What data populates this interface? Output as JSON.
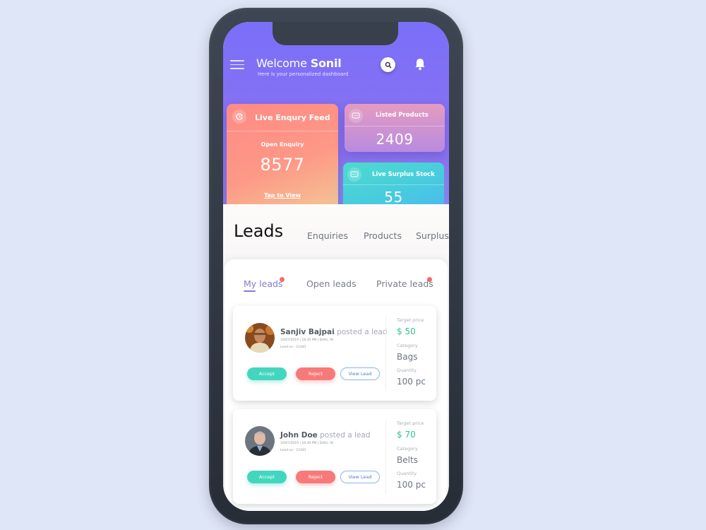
{
  "header": {
    "welcome_prefix": "Welcome",
    "user_name": "Sonil",
    "subtitle": "Here is your personalized dashboard"
  },
  "cards": {
    "enquiry": {
      "title": "Live Enqury Feed",
      "label": "Open Enquiry",
      "value": "8577",
      "link": "Tap to View"
    },
    "listed": {
      "title": "Listed Products",
      "value": "2409"
    },
    "surplus": {
      "title": "Live Surplus Stock",
      "value": "55"
    }
  },
  "leads": {
    "title": "Leads",
    "top_tabs": [
      {
        "label": "Enquiries"
      },
      {
        "label": "Products"
      },
      {
        "label": "Surplus"
      }
    ],
    "sub_tabs": [
      {
        "label": "My leads",
        "active": true,
        "badge": true
      },
      {
        "label": "Open leads",
        "active": false,
        "badge": false
      },
      {
        "label": "Private leads",
        "active": false,
        "badge": true
      }
    ],
    "items": [
      {
        "name": "Sanjiv Bajpai",
        "action": "posted a lead",
        "meta": "10/07/2019 | 18:30 PM | Delhi, IN",
        "lead_no": "Lead no - 12345",
        "target_price_label": "Target price",
        "target_price": "$ 50",
        "category_label": "Category",
        "category": "Bags",
        "quantity_label": "Quantity",
        "quantity": "100 pc",
        "accept_label": "Accept",
        "reject_label": "Reject",
        "view_label": "View Lead"
      },
      {
        "name": "John Doe",
        "action": "posted a lead",
        "meta": "10/07/2019 | 18:30 PM | Delhi, IN",
        "lead_no": "Lead no - 12345",
        "target_price_label": "Target price",
        "target_price": "$ 70",
        "category_label": "Category",
        "category": "Belts",
        "quantity_label": "Quantity",
        "quantity": "100 pc",
        "accept_label": "Accept",
        "reject_label": "Reject",
        "view_label": "View Lead"
      }
    ]
  },
  "colors": {
    "header": "#7a6ff9",
    "accent_tab": "#8a78d6",
    "accept": "#43d6bf",
    "reject": "#f87979",
    "price": "#2fc48c",
    "badge": "#f26a6a"
  }
}
